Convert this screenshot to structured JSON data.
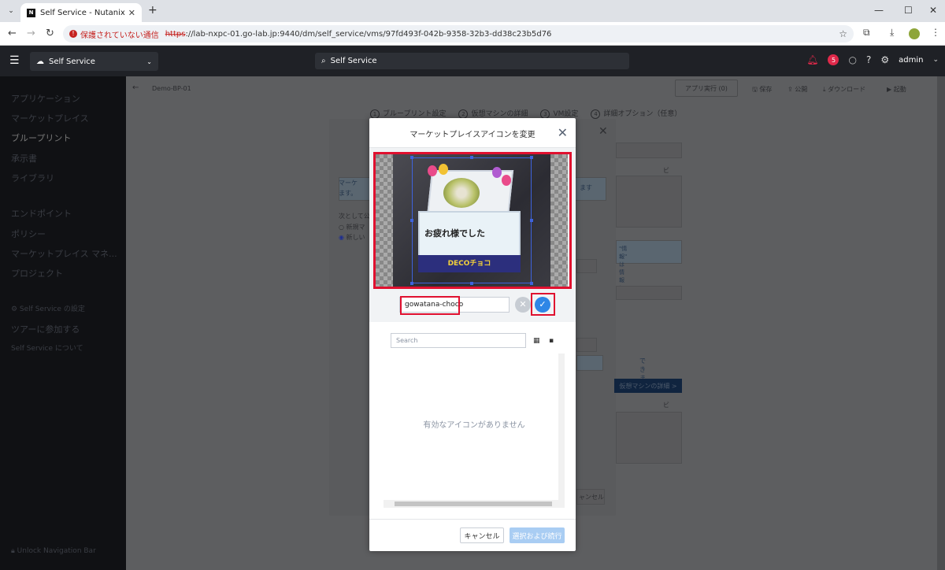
{
  "browser": {
    "tab_title": "Self Service - Nutanix",
    "tab_favicon": "N",
    "security_label": "保護されていない通信",
    "url_scheme": "https",
    "url_rest": "://lab-nxpc-01.go-lab.jp:9440/dm/self_service/vms/97fd493f-042b-9358-32b3-dd38c23b5d76"
  },
  "app": {
    "selector_label": "Self Service",
    "search_text": "Self Service",
    "notification_count": "5",
    "user": "admin"
  },
  "sidebar": {
    "items": [
      "アプリケーション",
      "マーケットプレイス",
      "ブループリント",
      "承示書",
      "ライブラリ",
      "エンドポイント",
      "ポリシー",
      "マーケットプレイス マネ...",
      "プロジェクト",
      "⚙ Self Service の設定",
      "ツアーに参加する",
      "Self Service について"
    ],
    "unlock_label": "Unlock Navigation Bar"
  },
  "page": {
    "breadcrumb": "Demo-BP-01",
    "publish_button": "アプリ実行 (0)",
    "actions": [
      "保存",
      "公開",
      "ダウンロード",
      "起動"
    ],
    "steps": [
      {
        "num": "1",
        "label": "ブループリント設定"
      },
      {
        "num": "2",
        "label": "仮想マシンの詳細"
      },
      {
        "num": "3",
        "label": "VM設定"
      },
      {
        "num": "4",
        "label": "詳細オプション（任意）"
      }
    ],
    "bg_modal": {
      "info_1": "マーケ",
      "info_2": "ます。",
      "info_right": "ます",
      "question": "次として公",
      "radio_1": "新規マ",
      "radio_2": "新しい",
      "preview_1": "ビュー",
      "hint": "\"情報\" は情報に",
      "hint2": "に",
      "notice": "できます。",
      "next_button": "仮想マシンの詳細 >",
      "preview_2": "ビュー",
      "cancel_button": "ャンセル"
    }
  },
  "dialog": {
    "title": "マーケットプレイスアイコンを変更",
    "image_caption_1": "お疲れ様でした",
    "image_caption_2": "DECOチョコ",
    "name_value": "gowatana-choco",
    "search_placeholder": "Search",
    "empty_message": "有効なアイコンがありません",
    "cancel_label": "キャンセル",
    "confirm_label": "選択および続行"
  },
  "colors": {
    "accent": "#2f86e6",
    "highlight": "#e0102f",
    "appbar": "#1f2126",
    "sidebar": "#101114"
  }
}
